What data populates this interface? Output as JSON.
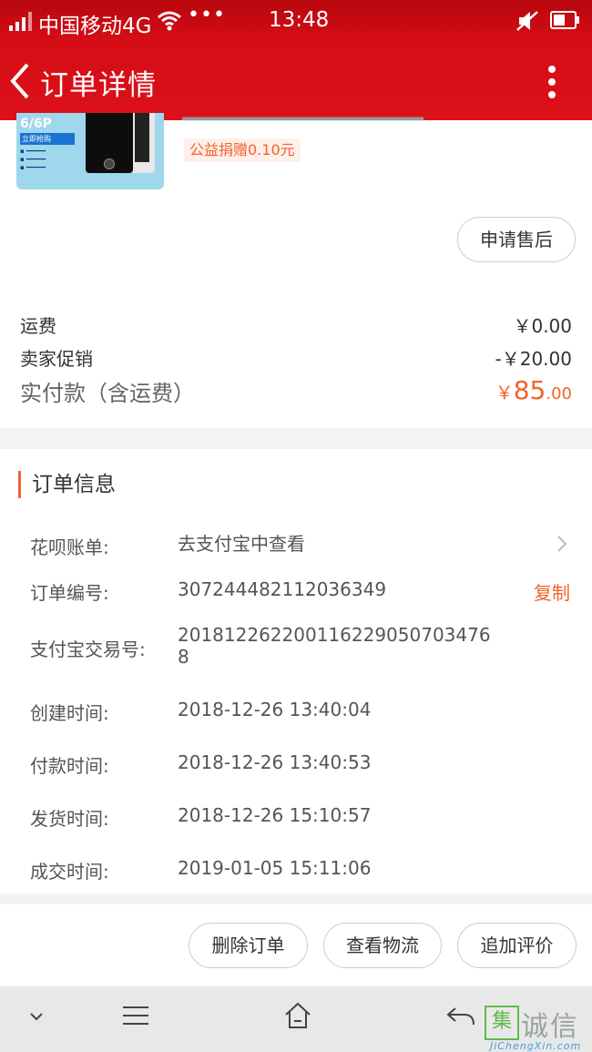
{
  "status_bar": {
    "carrier": "中国移动4G",
    "more_dots": "•••",
    "time": "13:48"
  },
  "nav": {
    "title": "订单详情"
  },
  "product": {
    "thumbnail_model": "6/6P",
    "thumbnail_buy": "立即抢购",
    "charity_badge": "公益捐赠0.10元",
    "after_sale_button": "申请售后"
  },
  "fees": {
    "shipping_label": "运费",
    "shipping_value": "￥0.00",
    "promo_label": "卖家促销",
    "promo_value": "-￥20.00",
    "total_label": "实付款（含运费）",
    "total_currency": "￥",
    "total_integer": "85",
    "total_decimal": ".00"
  },
  "order_info": {
    "title": "订单信息",
    "rows": [
      {
        "label": "花呗账单:",
        "value": "去支付宝中查看"
      },
      {
        "label": "订单编号:",
        "value": "307244482112036349",
        "action": "复制"
      },
      {
        "label": "支付宝交易号:",
        "value": "2018122622001162290507034768"
      },
      {
        "label": "创建时间:",
        "value": "2018-12-26 13:40:04"
      },
      {
        "label": "付款时间:",
        "value": "2018-12-26 13:40:53"
      },
      {
        "label": "发货时间:",
        "value": "2018-12-26 15:10:57"
      },
      {
        "label": "成交时间:",
        "value": "2019-01-05 15:11:06"
      }
    ]
  },
  "actions": {
    "delete": "删除订单",
    "logistics": "查看物流",
    "review": "追加评价"
  },
  "watermark": {
    "logo": "集",
    "text": "诚信",
    "domain": "JiChengXin.com"
  },
  "colors": {
    "brand_red": "#d60d16",
    "accent_orange": "#f2632a"
  }
}
